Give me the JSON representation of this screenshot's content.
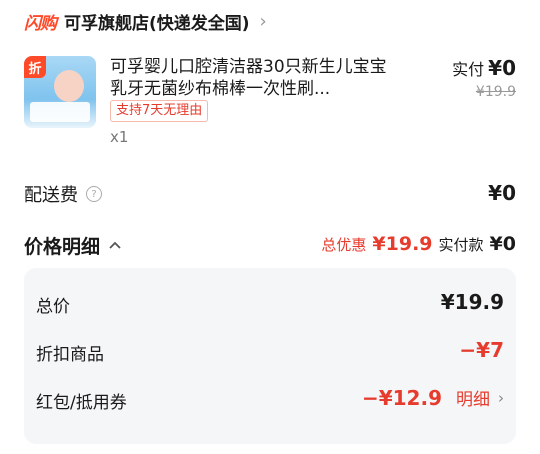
{
  "store": {
    "logo_text": "闪购",
    "name": "可孚旗舰店(快递发全国)",
    "chevron": "›"
  },
  "product": {
    "thumb_tag": "折",
    "title": "可孚婴儿口腔清洁器30只新生儿宝宝乳牙无菌纱布棉棒一次性刷...",
    "badge": "支持7天无理由",
    "qty": "x1",
    "paid_label": "实付",
    "paid_value": "¥0",
    "original_price": "¥19.9"
  },
  "shipping": {
    "label": "配送费",
    "value": "¥0"
  },
  "price_detail": {
    "title": "价格明细",
    "chevron": "^",
    "discount_label": "总优惠",
    "discount_value": "¥19.9",
    "pay_label": "实付款",
    "pay_value": "¥0"
  },
  "breakdown": {
    "total_label": "总价",
    "total_value": "¥19.9",
    "discount_item_label": "折扣商品",
    "discount_item_value": "−¥7",
    "coupon_label": "红包/抵用券",
    "coupon_value": "−¥12.9",
    "detail_link": "明细",
    "detail_chevron": "›"
  }
}
